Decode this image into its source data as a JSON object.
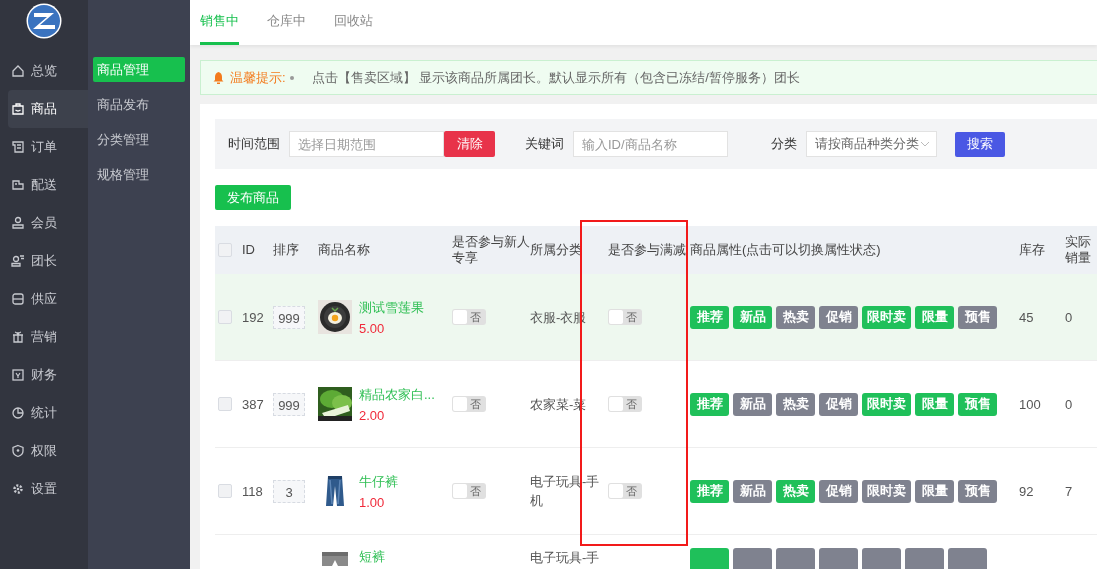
{
  "main_menu": [
    {
      "label": "总览",
      "selected": false
    },
    {
      "label": "商品",
      "selected": true
    },
    {
      "label": "订单",
      "selected": false
    },
    {
      "label": "配送",
      "selected": false
    },
    {
      "label": "会员",
      "selected": false
    },
    {
      "label": "团长",
      "selected": false
    },
    {
      "label": "供应",
      "selected": false
    },
    {
      "label": "营销",
      "selected": false
    },
    {
      "label": "财务",
      "selected": false
    },
    {
      "label": "统计",
      "selected": false
    },
    {
      "label": "权限",
      "selected": false
    },
    {
      "label": "设置",
      "selected": false
    }
  ],
  "sub_menu": [
    {
      "label": "商品管理",
      "selected": true
    },
    {
      "label": "商品发布",
      "selected": false
    },
    {
      "label": "分类管理",
      "selected": false
    },
    {
      "label": "规格管理",
      "selected": false
    }
  ],
  "tabs": [
    {
      "label": "销售中",
      "selected": true
    },
    {
      "label": "仓库中",
      "selected": false
    },
    {
      "label": "回收站",
      "selected": false
    }
  ],
  "notice": {
    "title": "温馨提示:",
    "text": "点击【售卖区域】 显示该商品所属团长。默认显示所有（包含已冻结/暂停服务）团长"
  },
  "filters": {
    "date_label": "时间范围",
    "date_placeholder": "选择日期范围",
    "clear_button": "清除",
    "keyword_label": "关键词",
    "keyword_placeholder": "输入ID/商品名称",
    "category_label": "分类",
    "category_placeholder": "请按商品种类分类",
    "search_button": "搜索"
  },
  "publish_button": "发布商品",
  "table": {
    "header_checked": false,
    "columns": [
      "ID",
      "排序",
      "商品名称",
      "是否参与新人专享",
      "所属分类",
      "是否参与满减",
      "商品属性(点击可以切换属性状态)",
      "库存",
      "实际销量"
    ],
    "rows": [
      {
        "checked": false,
        "highlighted": true,
        "id": "192",
        "sort": "999",
        "name": "测试雪莲果",
        "price": "5.00",
        "newcomer": {
          "on": false,
          "label": "否"
        },
        "category": "衣服-衣服",
        "discount": {
          "on": false,
          "label": "否"
        },
        "tags": [
          {
            "label": "推荐",
            "on": true
          },
          {
            "label": "新品",
            "on": true
          },
          {
            "label": "热卖",
            "on": false
          },
          {
            "label": "促销",
            "on": false
          },
          {
            "label": "限时卖",
            "on": true
          },
          {
            "label": "限量",
            "on": true
          },
          {
            "label": "预售",
            "on": false
          }
        ],
        "stock": "45",
        "sales": "0"
      },
      {
        "checked": false,
        "highlighted": false,
        "id": "387",
        "sort": "999",
        "name": "精品农家白...",
        "price": "2.00",
        "newcomer": {
          "on": false,
          "label": "否"
        },
        "category": "农家菜-菜",
        "discount": {
          "on": false,
          "label": "否"
        },
        "tags": [
          {
            "label": "推荐",
            "on": true
          },
          {
            "label": "新品",
            "on": false
          },
          {
            "label": "热卖",
            "on": false
          },
          {
            "label": "促销",
            "on": false
          },
          {
            "label": "限时卖",
            "on": true
          },
          {
            "label": "限量",
            "on": true
          },
          {
            "label": "预售",
            "on": true
          }
        ],
        "stock": "100",
        "sales": "0"
      },
      {
        "checked": false,
        "highlighted": false,
        "id": "118",
        "sort": "3",
        "name": "牛仔裤",
        "price": "1.00",
        "newcomer": {
          "on": false,
          "label": "否"
        },
        "category": "电子玩具-手机",
        "discount": {
          "on": false,
          "label": "否"
        },
        "tags": [
          {
            "label": "推荐",
            "on": true
          },
          {
            "label": "新品",
            "on": false
          },
          {
            "label": "热卖",
            "on": true
          },
          {
            "label": "促销",
            "on": false
          },
          {
            "label": "限时卖",
            "on": false
          },
          {
            "label": "限量",
            "on": false
          },
          {
            "label": "预售",
            "on": false
          }
        ],
        "stock": "92",
        "sales": "7"
      },
      {
        "highlighted": false,
        "name": "短裤",
        "category": "电子玩具-手",
        "tags": [
          {
            "on": true
          },
          {
            "on": false
          },
          {
            "on": false
          },
          {
            "on": false
          },
          {
            "on": false
          },
          {
            "on": false
          },
          {
            "on": false
          }
        ]
      }
    ]
  },
  "annotation": {
    "kind": "rectangle"
  }
}
